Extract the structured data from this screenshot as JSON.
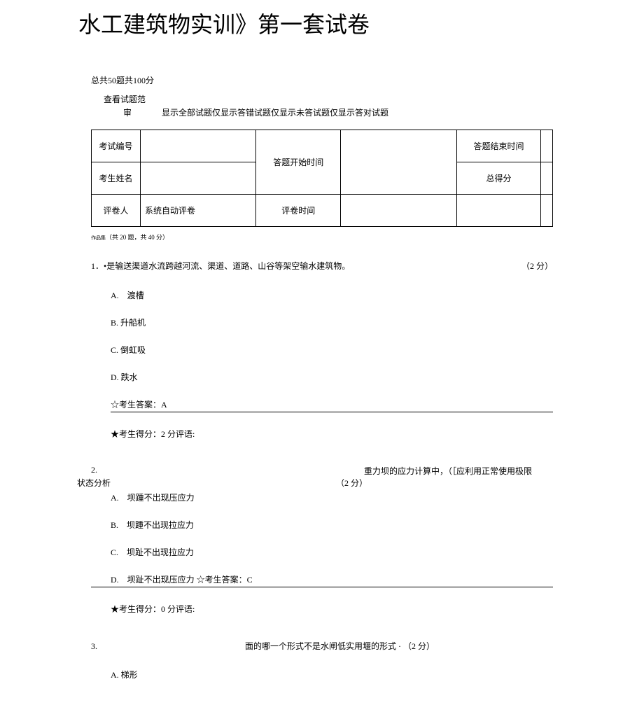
{
  "title": "水工建筑物实训》第一套试卷",
  "summary": "总共50题共100分",
  "review": {
    "line1": "查看试题范",
    "line2_left": "审",
    "filters": "显示全部试题仅显示答错试题仅显示未答试题仅显示答对试题"
  },
  "info_table": {
    "exam_id_label": "考试编号",
    "exam_id_value": "",
    "start_time_label": "答题开始时间",
    "start_time_value": "",
    "end_time_label": "答题结束时间",
    "end_time_value": "",
    "name_label": "考生姓名",
    "name_value": "",
    "total_score_label": "总得分",
    "total_score_value": "",
    "grader_label": "评卷人",
    "grader_value": "系统自动评卷",
    "grade_time_label": "评卷时间",
    "grade_time_value": ""
  },
  "section": {
    "tiny": "作品集",
    "text": "（共 20 题，共 40 分）"
  },
  "q1": {
    "stem_num": "1．",
    "stem_text": "•是输送渠道水流跨越河流、渠道、道路、山谷等架空输水建筑物。",
    "points": "（2 分）",
    "optA": "A.　渡槽",
    "optB": "B. 升船机",
    "optC": "C. 倒虹吸",
    "optD": "D. 跌水",
    "answer": "☆考生答案：A",
    "score": "★考生得分：2 分评语:"
  },
  "q2": {
    "num": "2.",
    "right_text": "重力坝的应力计算中，（［应利用正常使用极限",
    "state": "状态分析",
    "points": "（2 分）",
    "optA": "A.　坝踵不出现压应力",
    "optB": "B.　坝踵不出现拉应力",
    "optC": "C.　坝趾不出现拉应力",
    "optD": "D.　坝趾不出现压应力 ☆考生答案：C",
    "score": "★考生得分：0 分评语:"
  },
  "q3": {
    "num": "3.",
    "text": "面的哪一个形式不是水闸低实用堰的形式 · （2 分）",
    "optA": "A. 梯形"
  }
}
